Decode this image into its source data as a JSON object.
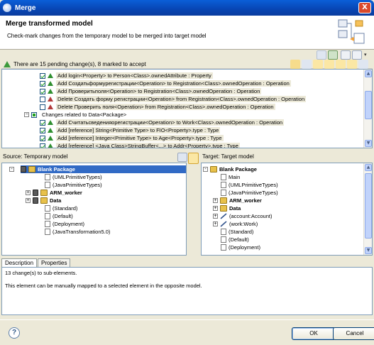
{
  "window": {
    "title": "Merge",
    "close_label": "X"
  },
  "header": {
    "title": "Merge transformed model",
    "description": "Check-mark changes from the temporary model to be merged into target model"
  },
  "status": {
    "text": "There are 15 pending change(s), 8 marked to accept"
  },
  "changes": [
    {
      "text": "Add login<Property> to Person<Class>.ownedAttribute : Property",
      "state": "checked",
      "kind": "add"
    },
    {
      "text": "Add Создатьформурегистрации<Operation> to Registration<Class>.ownedOperation : Operation",
      "state": "checked",
      "kind": "add"
    },
    {
      "text": "Add Проверитьполя<Operation> to Registration<Class>.ownedOperation : Operation",
      "state": "checked",
      "kind": "add"
    },
    {
      "text": "Delete Создать форму регистрации<Operation> from Registration<Class>.ownedOperation : Operation",
      "state": "unchecked",
      "kind": "delete"
    },
    {
      "text": "Delete Проверить поля<Operation> from Registration<Class>.ownedOperation : Operation",
      "state": "unchecked",
      "kind": "delete"
    },
    {
      "text": "Changes related to Data<Package>",
      "state": "mixed",
      "kind": "group"
    },
    {
      "text": "Add Считатьсведенияорегистрации<Operation> to Work<Class>.ownedOperation : Operation",
      "state": "checked",
      "kind": "add"
    },
    {
      "text": "Add [reference] String<Primitive Type> to FIO<Property>.type : Type",
      "state": "checked",
      "kind": "add"
    },
    {
      "text": "Add [reference] Integer<Primitive Type> to Age<Property>.type : Type",
      "state": "checked",
      "kind": "add"
    },
    {
      "text": "Add [reference] <Java Class>StringBuffer<...> to Addr<Property>.type : Type",
      "state": "checked",
      "kind": "add"
    }
  ],
  "source": {
    "label": "Source: Temporary model",
    "items": [
      {
        "text": "Blank Package",
        "bold": true,
        "icon": "package-icon",
        "selected": true,
        "expander": "-"
      },
      {
        "text": "(UMLPrimitiveTypes)",
        "icon": "import-icon"
      },
      {
        "text": "(JavaPrimitiveTypes)",
        "icon": "import-icon"
      },
      {
        "text": "ARM_worker",
        "bold": true,
        "icon": "package-icon",
        "expander": "+"
      },
      {
        "text": "Data",
        "bold": true,
        "icon": "package-icon",
        "expander": "+"
      },
      {
        "text": "(Standard)",
        "icon": "import-icon"
      },
      {
        "text": "(Default)",
        "icon": "import-icon"
      },
      {
        "text": "(Deployment)",
        "icon": "import-icon"
      },
      {
        "text": "(JavaTransformation5.0)",
        "icon": "import-icon"
      }
    ]
  },
  "target": {
    "label": "Target: Target model",
    "items": [
      {
        "text": "Blank Package",
        "bold": true,
        "icon": "package-icon",
        "expander": "-"
      },
      {
        "text": "Main",
        "icon": "diagram-icon"
      },
      {
        "text": "(UMLPrimitiveTypes)",
        "icon": "import-icon"
      },
      {
        "text": "(JavaPrimitiveTypes)",
        "icon": "import-icon"
      },
      {
        "text": "ARM_worker",
        "bold": true,
        "icon": "package-icon",
        "expander": "+"
      },
      {
        "text": "Data",
        "bold": true,
        "icon": "package-icon",
        "expander": "+"
      },
      {
        "text": "(account:Account)",
        "icon": "association-icon",
        "expander": "+"
      },
      {
        "text": "(work:Work)",
        "icon": "association-icon",
        "expander": "+"
      },
      {
        "text": "(Standard)",
        "icon": "import-icon"
      },
      {
        "text": "(Default)",
        "icon": "import-icon"
      },
      {
        "text": "(Deployment)",
        "icon": "import-icon"
      }
    ]
  },
  "tabs": [
    {
      "label": "Description",
      "active": true
    },
    {
      "label": "Properties",
      "active": false
    }
  ],
  "description": {
    "line1": "13 change(s) to sub-elements.",
    "line2": "This element can be manually mapped to a selected element in the opposite model."
  },
  "buttons": {
    "ok": "OK",
    "cancel": "Cancel",
    "help": "?"
  },
  "colors": {
    "titlebar": "#0a5fd8",
    "selection": "#316ac5",
    "check": "#21a121"
  }
}
